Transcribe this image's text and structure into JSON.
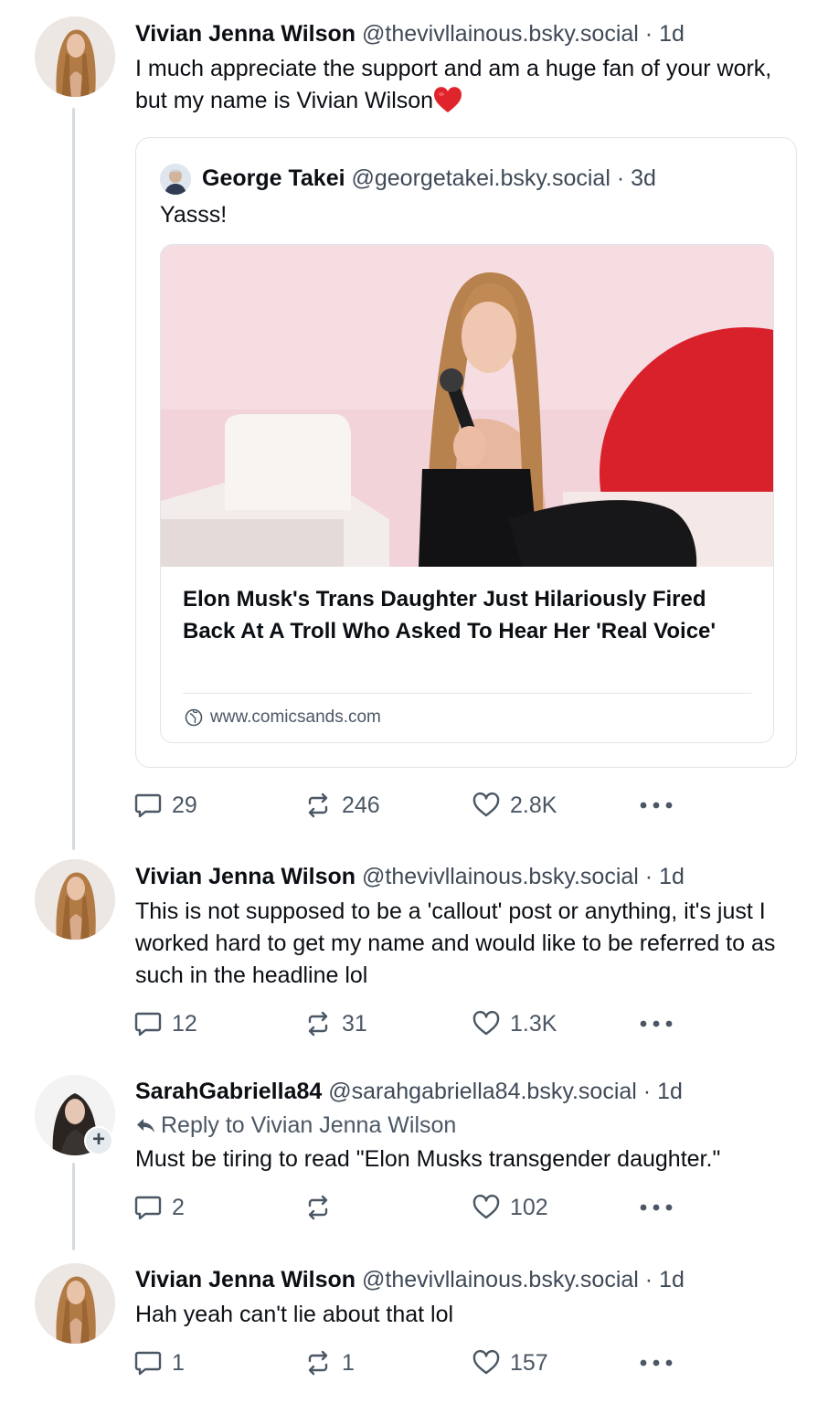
{
  "colors": {
    "heart": "#e0242b",
    "muted": "#4b5765",
    "border": "#dfe4ea",
    "thread": "#d4dbe2"
  },
  "posts": [
    {
      "name": "Vivian Jenna Wilson",
      "handle": "@thevivllainous.bsky.social",
      "time": "1d",
      "text": "I much appreciate the support and am a huge fan of your work, but my name is Vivian Wilson",
      "emoji": "heart",
      "quote": {
        "name": "George Takei",
        "handle": "@georgetakei.bsky.social",
        "time": "3d",
        "text": "Yasss!",
        "link": {
          "title": "Elon Musk's Trans Daughter Just Hilariously Fired Back At A Troll Who Asked To Hear Her 'Real Voice'",
          "domain": "www.comicsands.com"
        }
      },
      "stats": {
        "replies": "29",
        "reposts": "246",
        "likes": "2.8K"
      }
    },
    {
      "name": "Vivian Jenna Wilson",
      "handle": "@thevivllainous.bsky.social",
      "time": "1d",
      "text": "This is not supposed to be a 'callout' post or anything, it's just I worked hard to get my name and would like to be referred to as such in the headline lol",
      "stats": {
        "replies": "12",
        "reposts": "31",
        "likes": "1.3K"
      }
    },
    {
      "name": "SarahGabriella84",
      "handle": "@sarahgabriella84.bsky.social",
      "time": "1d",
      "reply_to": "Reply to Vivian Jenna Wilson",
      "text": "Must be tiring to read \"Elon Musks transgender daughter.\"",
      "stats": {
        "replies": "2",
        "reposts": "",
        "likes": "102"
      }
    },
    {
      "name": "Vivian Jenna Wilson",
      "handle": "@thevivllainous.bsky.social",
      "time": "1d",
      "text": "Hah yeah can't lie about that lol",
      "stats": {
        "replies": "1",
        "reposts": "1",
        "likes": "157"
      }
    }
  ],
  "separator": "·",
  "plus_badge": "+"
}
